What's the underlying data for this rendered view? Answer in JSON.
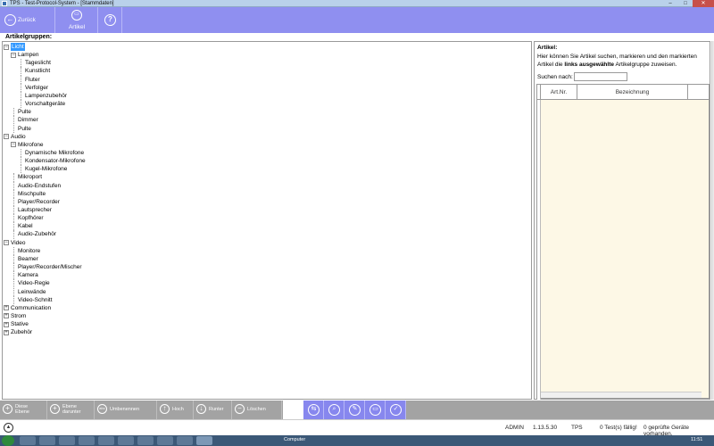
{
  "window": {
    "title": "TPS - Test-Protocol-System - [Stammdaten]",
    "controls": [
      "–",
      "□",
      "✕"
    ]
  },
  "toolbar": {
    "back_label": "Zurück",
    "article_label": "Artikel"
  },
  "header": {
    "label": "Artikelgruppen:"
  },
  "tree": [
    {
      "label": "Licht",
      "level": 0,
      "exp": "-",
      "sel": true
    },
    {
      "label": "Lampen",
      "level": 1,
      "exp": "-"
    },
    {
      "label": "Tageslicht",
      "level": 2
    },
    {
      "label": "Kunstlicht",
      "level": 2
    },
    {
      "label": "Fluter",
      "level": 2
    },
    {
      "label": "Verfolger",
      "level": 2
    },
    {
      "label": "Lampenzubehör",
      "level": 2
    },
    {
      "label": "Vorschaltgeräte",
      "level": 2
    },
    {
      "label": "Pulte",
      "level": 1
    },
    {
      "label": "Dimmer",
      "level": 1
    },
    {
      "label": "Pulte",
      "level": 1
    },
    {
      "label": "Audio",
      "level": 0,
      "exp": "-"
    },
    {
      "label": "Mikrofone",
      "level": 1,
      "exp": "-"
    },
    {
      "label": "Dynamische Mikrofone",
      "level": 2
    },
    {
      "label": "Kondensator-Mikrofone",
      "level": 2
    },
    {
      "label": "Kugel-Mikrofone",
      "level": 2
    },
    {
      "label": "Mikroport",
      "level": 1
    },
    {
      "label": "Audio-Endstufen",
      "level": 1
    },
    {
      "label": "Mischpulte",
      "level": 1
    },
    {
      "label": "Player/Recorder",
      "level": 1
    },
    {
      "label": "Lautsprecher",
      "level": 1
    },
    {
      "label": "Kopfhörer",
      "level": 1
    },
    {
      "label": "Kabel",
      "level": 1
    },
    {
      "label": "Audio-Zubehör",
      "level": 1
    },
    {
      "label": "Video",
      "level": 0,
      "exp": "-"
    },
    {
      "label": "Monitore",
      "level": 1
    },
    {
      "label": "Beamer",
      "level": 1
    },
    {
      "label": "Player/Recorder/Mischer",
      "level": 1
    },
    {
      "label": "Kamera",
      "level": 1
    },
    {
      "label": "Video-Regie",
      "level": 1
    },
    {
      "label": "Leinwände",
      "level": 1
    },
    {
      "label": "Video-Schnitt",
      "level": 1
    },
    {
      "label": "Communication",
      "level": 0,
      "exp": "+"
    },
    {
      "label": "Strom",
      "level": 0,
      "exp": "+"
    },
    {
      "label": "Stative",
      "level": 0,
      "exp": "+"
    },
    {
      "label": "Zubehör",
      "level": 0,
      "exp": "+"
    }
  ],
  "right_panel": {
    "title": "Artikel:",
    "desc_pre": "Hier können Sie Artikel suchen, markieren und den markierten Artikel die ",
    "desc_bold": "links ausgewählte",
    "desc_post": " Artikelgruppe zuweisen.",
    "search_label": "Suchen  nach:",
    "search_value": "",
    "columns": [
      "Art.Nr.",
      "Bezeichnung"
    ]
  },
  "bottombar": {
    "buttons": [
      {
        "name": "diese-ebene-button",
        "l1": "Diese",
        "l2": "Ebene",
        "icon": "+"
      },
      {
        "name": "ebene-darunter-button",
        "l1": "Ebene",
        "l2": "darunter",
        "icon": "+"
      },
      {
        "name": "umbenennen-button",
        "l1": "Umbenennen",
        "l2": "",
        "icon": "abc"
      },
      {
        "name": "hoch-button",
        "l1": "Hoch",
        "l2": "",
        "icon": "↑"
      },
      {
        "name": "runter-button",
        "l1": "Runter",
        "l2": "",
        "icon": "↓"
      },
      {
        "name": "loeschen-button",
        "l1": "Löschen",
        "l2": "",
        "icon": "−"
      }
    ]
  },
  "status": {
    "user": "ADMIN",
    "version": "1.13.5.30",
    "app": "TPS",
    "tests": "0 Test(s) fällig!",
    "devices": "0 geprüfte Geräte vorhanden."
  },
  "taskbar": {
    "computer": "Computer",
    "clock": "11:51"
  },
  "colors": {
    "accent": "#8f8ff0",
    "selection": "#3399ff",
    "grid_bg": "#fdf8e6"
  }
}
